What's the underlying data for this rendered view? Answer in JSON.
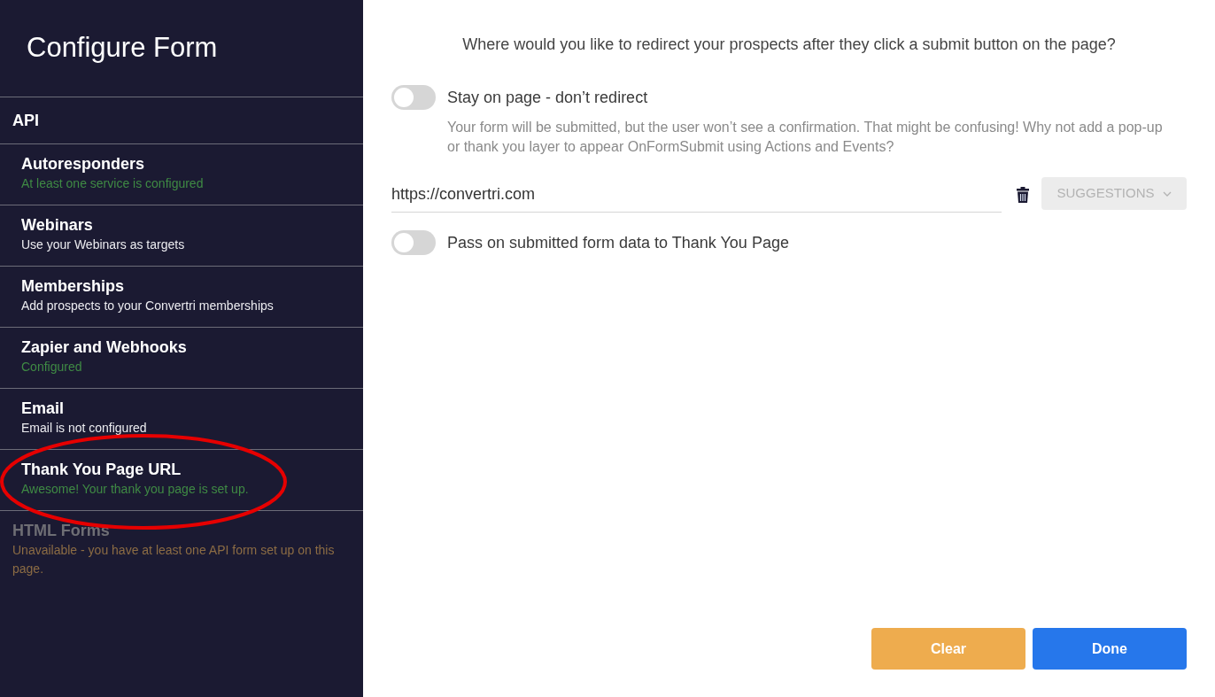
{
  "sidebar": {
    "title": "Configure Form",
    "section": "API",
    "items": [
      {
        "title": "Autoresponders",
        "status": "At least one service is configured",
        "kind": "configured",
        "disabled": false,
        "circled": false
      },
      {
        "title": "Webinars",
        "status": "Use your Webinars as targets",
        "kind": "info",
        "disabled": false,
        "circled": false
      },
      {
        "title": "Memberships",
        "status": "Add prospects to your Convertri memberships",
        "kind": "info",
        "disabled": false,
        "circled": false
      },
      {
        "title": "Zapier and Webhooks",
        "status": "Configured",
        "kind": "configured",
        "disabled": false,
        "circled": false
      },
      {
        "title": "Email",
        "status": "Email is not configured",
        "kind": "info",
        "disabled": false,
        "circled": false
      },
      {
        "title": "Thank You Page URL",
        "status": "Awesome! Your thank you page is set up.",
        "kind": "configured",
        "disabled": false,
        "circled": true
      },
      {
        "title": "HTML Forms",
        "status": "Unavailable - you have at least one API form set up on this page.",
        "kind": "unavailable",
        "disabled": true,
        "circled": false
      }
    ]
  },
  "main": {
    "question": "Where would you like to redirect your prospects after they click a submit button on the page?",
    "stay_toggle": {
      "label": "Stay on page - don’t redirect",
      "on": false,
      "description": "Your form will be submitted, but the user won’t see a confirmation. That might be confusing! Why not add a pop-up or thank you layer to appear OnFormSubmit using Actions and Events?"
    },
    "url_field": {
      "value": "https://convertri.com"
    },
    "suggestions_button": {
      "label": "SUGGESTIONS",
      "disabled": true
    },
    "pass_toggle": {
      "label": "Pass on submitted form data to Thank You Page",
      "on": false
    },
    "buttons": [
      {
        "label": "Clear",
        "kind": "warning"
      },
      {
        "label": "Done",
        "kind": "primary"
      }
    ]
  }
}
